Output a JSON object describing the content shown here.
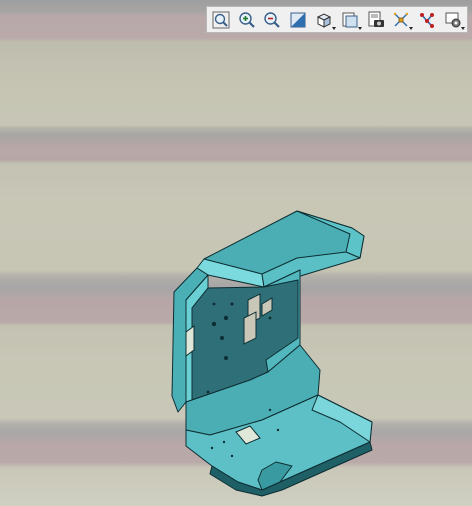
{
  "toolbar": {
    "buttons": [
      {
        "icon": "zoom-fit-icon",
        "has_dropdown": false
      },
      {
        "icon": "zoom-in-icon",
        "has_dropdown": false
      },
      {
        "icon": "zoom-out-icon",
        "has_dropdown": false
      },
      {
        "icon": "display-mode-icon",
        "has_dropdown": false
      },
      {
        "icon": "view-cube-icon",
        "has_dropdown": true
      },
      {
        "icon": "view-options-icon",
        "has_dropdown": true
      },
      {
        "icon": "screenshot-icon",
        "has_dropdown": false
      },
      {
        "icon": "explode-icon",
        "has_dropdown": true
      },
      {
        "icon": "connectors-icon",
        "has_dropdown": false
      },
      {
        "icon": "settings-icon",
        "has_dropdown": true
      }
    ]
  },
  "colors": {
    "part_face": "#4aaeb4",
    "part_top": "#78d8dc",
    "part_dark": "#1f5f66",
    "edge": "#0d2e33"
  }
}
